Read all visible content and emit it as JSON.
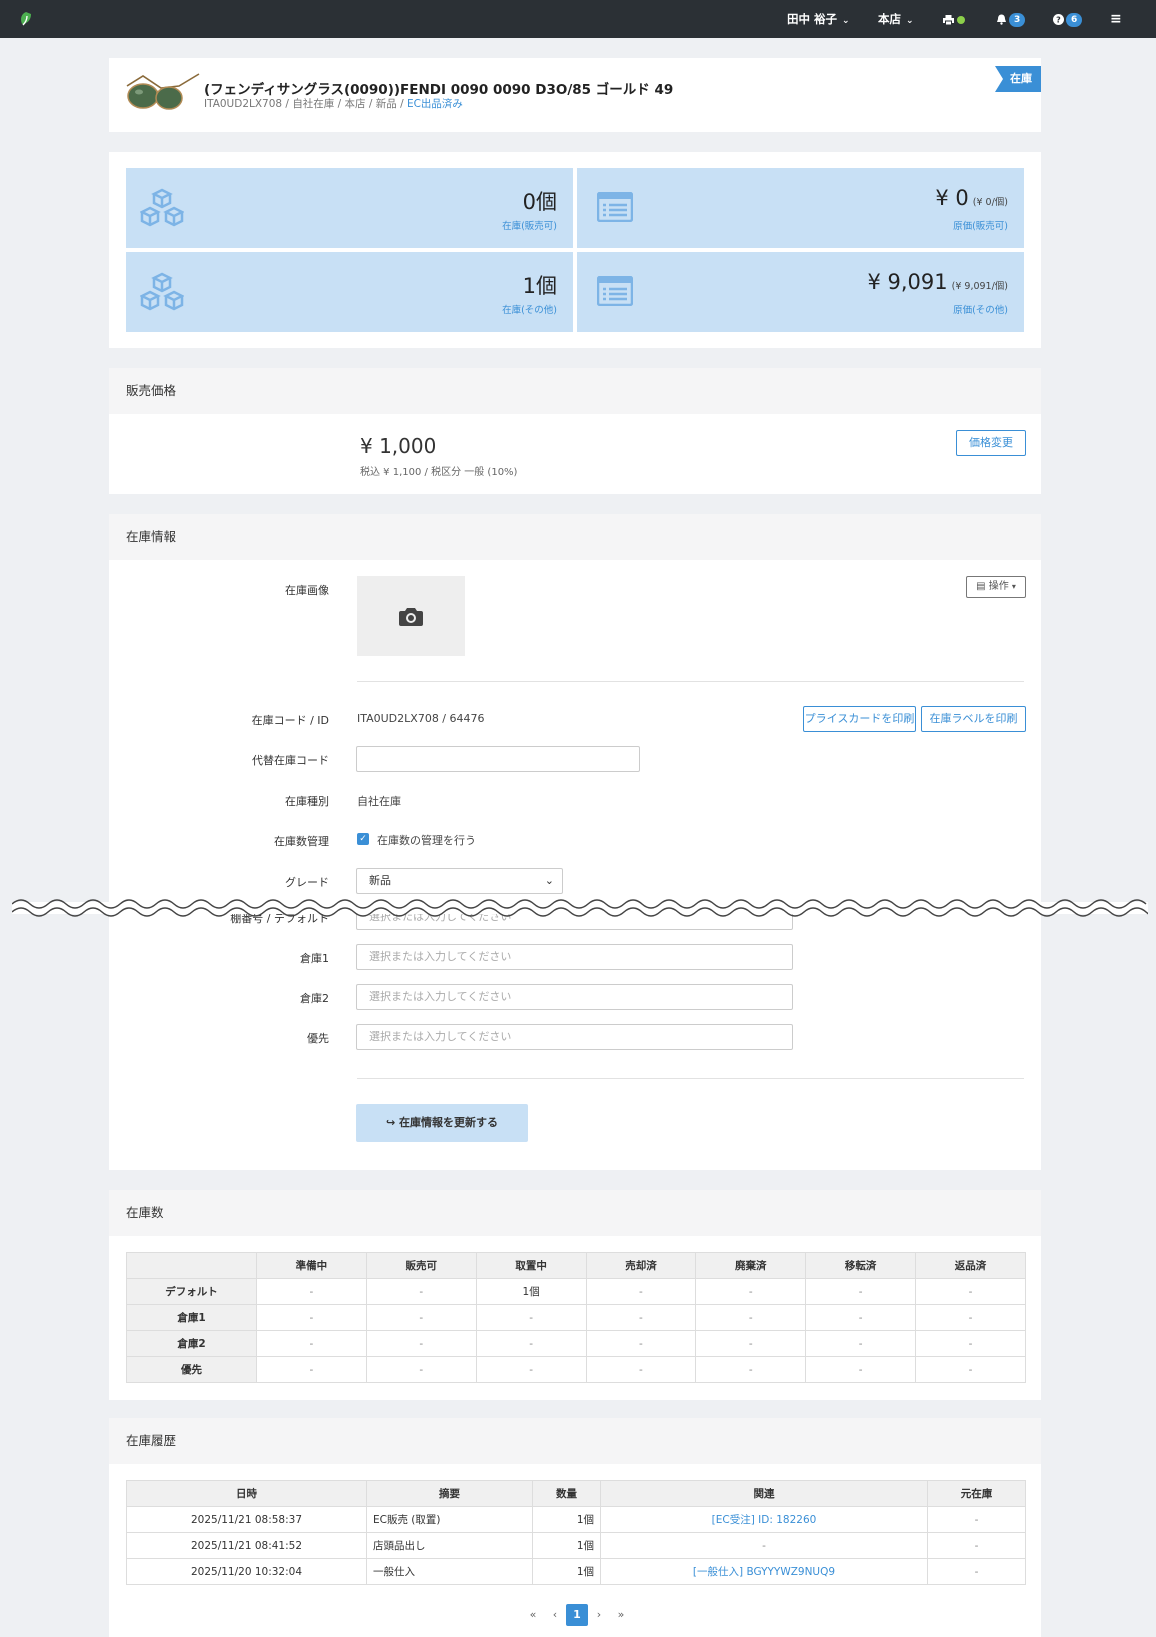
{
  "topbar": {
    "user": "田中 裕子",
    "store": "本店",
    "notifications": "3",
    "help": "6",
    "icons": [
      "printer-icon",
      "bell-icon",
      "help-icon",
      "menu-icon"
    ]
  },
  "product": {
    "title": "(フェンディサングラス(0090))FENDI 0090 0090 D3O/85 ゴールド 49",
    "code": "ITA0UD2LX708",
    "sub_parts": [
      "自社在庫",
      "本店",
      "新品"
    ],
    "ec_status": "EC出品済み",
    "ribbon": "在庫"
  },
  "stats": {
    "stock_sellable": {
      "value": "0個",
      "label": "在庫(販売可)"
    },
    "cost_sellable": {
      "value": "¥ 0",
      "unit": "(¥ 0/個)",
      "label": "原価(販売可)"
    },
    "stock_other": {
      "value": "1個",
      "label": "在庫(その他)"
    },
    "cost_other": {
      "value": "¥ 9,091",
      "unit": "(¥ 9,091/個)",
      "label": "原価(その他)"
    }
  },
  "price": {
    "header": "販売価格",
    "amount": "¥ 1,000",
    "tax_line": "税込 ¥ 1,100 / 税区分 一般 (10%)",
    "change_button": "価格変更"
  },
  "stock_info": {
    "header": "在庫情報",
    "image_label": "在庫画像",
    "ops_button": "操作",
    "code_label": "在庫コード / ID",
    "code_value": "ITA0UD2LX708 / 64476",
    "print_price_card": "プライスカードを印刷",
    "print_label": "在庫ラベルを印刷",
    "alt_code_label": "代替在庫コード",
    "alt_code_value": "",
    "type_label": "在庫種別",
    "type_value": "自社在庫",
    "manage_label": "在庫数管理",
    "manage_check": "在庫数の管理を行う",
    "grade_label": "グレード",
    "grade_value": "新品",
    "shelf_label": "棚番号 / デフォルト",
    "wh1_label": "倉庫1",
    "wh2_label": "倉庫2",
    "priority_label": "優先",
    "placeholder": "選択または入力してください",
    "update_button": "在庫情報を更新する"
  },
  "stock_counts": {
    "header": "在庫数",
    "columns": [
      "",
      "準備中",
      "販売可",
      "取置中",
      "売却済",
      "廃棄済",
      "移転済",
      "返品済"
    ],
    "rows": [
      {
        "name": "デフォルト",
        "cells": [
          "-",
          "-",
          "1個",
          "-",
          "-",
          "-",
          "-"
        ]
      },
      {
        "name": "倉庫1",
        "cells": [
          "-",
          "-",
          "-",
          "-",
          "-",
          "-",
          "-"
        ]
      },
      {
        "name": "倉庫2",
        "cells": [
          "-",
          "-",
          "-",
          "-",
          "-",
          "-",
          "-"
        ]
      },
      {
        "name": "優先",
        "cells": [
          "-",
          "-",
          "-",
          "-",
          "-",
          "-",
          "-"
        ]
      }
    ]
  },
  "history": {
    "header": "在庫履歴",
    "columns": [
      "日時",
      "摘要",
      "数量",
      "関連",
      "元在庫"
    ],
    "rows": [
      {
        "date": "2025/11/21 08:58:37",
        "summary": "EC販売 (取置)",
        "qty": "1個",
        "related": "[EC受注] ID: 182260",
        "origin": "-"
      },
      {
        "date": "2025/11/21 08:41:52",
        "summary": "店頭品出し",
        "qty": "1個",
        "related": "-",
        "origin": "-"
      },
      {
        "date": "2025/11/20 10:32:04",
        "summary": "一般仕入",
        "qty": "1個",
        "related": "[一般仕入] BGYYYWZ9NUQ9",
        "origin": "-"
      }
    ]
  },
  "pagination": {
    "first": "«",
    "prev": "‹",
    "current": "1",
    "next": "›",
    "last": "»"
  },
  "colors": {
    "accent": "#3a8fd6",
    "tile": "#c8e0f5",
    "topbar": "#2b3035"
  }
}
